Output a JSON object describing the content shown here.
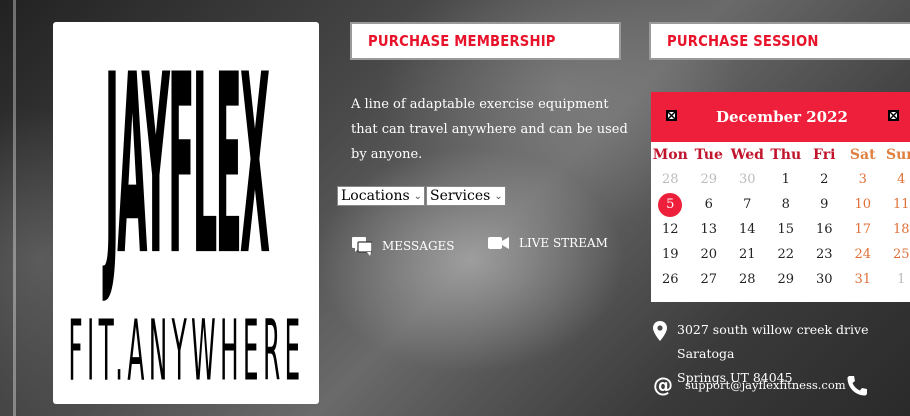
{
  "logo": {
    "main_text": "JAYFLEX",
    "sub_text": "FIT.ANYWHERE"
  },
  "header": {
    "purchase_membership_label": "PURCHASE MEMBERSHIP",
    "purchase_session_label": "PURCHASE SESSION"
  },
  "description": "A line of adaptable exercise equipment that can travel anywhere and can be used by anyone.",
  "selects": {
    "locations": "Locations",
    "services": "Services"
  },
  "links": {
    "messages": "MESSAGES",
    "live_stream": "LIVE STREAM"
  },
  "calendar": {
    "month_label": "December 2022",
    "weekdays": [
      "Mon",
      "Tue",
      "Wed",
      "Thu",
      "Fri",
      "Sat",
      "Sun"
    ],
    "weeks": [
      [
        "28",
        "29",
        "30",
        "1",
        "2",
        "3",
        "4"
      ],
      [
        "5",
        "6",
        "7",
        "8",
        "9",
        "10",
        "11"
      ],
      [
        "12",
        "13",
        "14",
        "15",
        "16",
        "17",
        "18"
      ],
      [
        "19",
        "20",
        "21",
        "22",
        "23",
        "24",
        "25"
      ],
      [
        "26",
        "27",
        "28",
        "29",
        "30",
        "31",
        "1"
      ]
    ],
    "today": "5",
    "accent_color": "#ee1f3a"
  },
  "contact": {
    "address_line1": "3027 south willow creek drive Saratoga",
    "address_line2": "Springs UT 84045",
    "email": "support@jayflexfitness.com",
    "at_symbol": "@"
  },
  "icons": {
    "messages": "chat-bubbles-icon",
    "live_stream": "video-camera-icon",
    "location": "map-pin-icon",
    "phone": "phone-icon",
    "cal_prev": "broken-image-icon",
    "cal_next": "broken-image-icon"
  }
}
